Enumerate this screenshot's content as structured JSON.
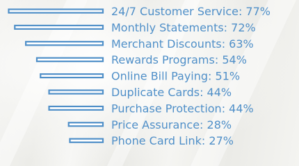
{
  "chart_data": {
    "type": "bar",
    "orientation": "horizontal",
    "categories": [
      "24/7 Customer Service",
      "Monthly Statements",
      "Merchant Discounts",
      "Rewards Programs",
      "Online Bill Paying",
      "Duplicate Cards",
      "Purchase Protection",
      "Price Assurance",
      "Phone Card Link"
    ],
    "values": [
      77,
      72,
      63,
      54,
      51,
      44,
      44,
      28,
      27
    ],
    "labels": [
      "24/7 Customer Service: 77%",
      "Monthly Statements: 72%",
      "Merchant Discounts: 63%",
      "Rewards Programs: 54%",
      "Online Bill Paying: 51%",
      "Duplicate Cards: 44%",
      "Purchase Protection: 44%",
      "Price Assurance: 28%",
      "Phone Card Link: 27%"
    ],
    "unit": "%",
    "title": "",
    "xlabel": "",
    "ylabel": "",
    "grid": false,
    "legend": "none"
  },
  "colors": {
    "bar_fill": "#ffffff",
    "bar_stroke": "#4f8fc8",
    "label_text": "#4f8fc8"
  }
}
